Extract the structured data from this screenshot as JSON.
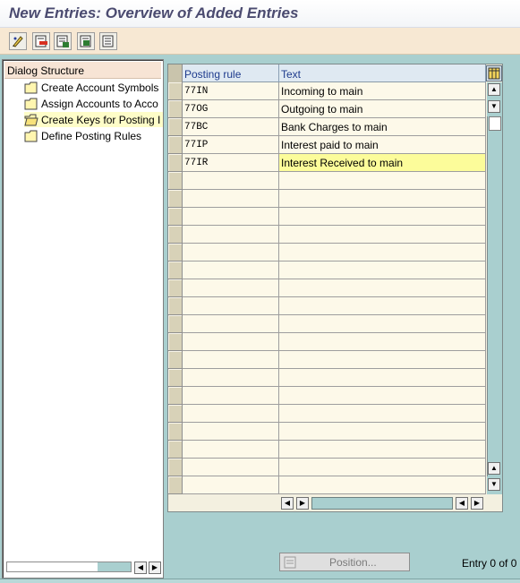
{
  "window": {
    "title": "New Entries: Overview of Added Entries"
  },
  "toolbar": {
    "buttons": [
      {
        "icon": "edit-pencil-icon"
      },
      {
        "icon": "delete-row-icon"
      },
      {
        "icon": "select-all-icon"
      },
      {
        "icon": "select-block-icon"
      },
      {
        "icon": "deselect-all-icon"
      }
    ]
  },
  "dialog_structure": {
    "header": "Dialog Structure",
    "items": [
      {
        "label": "Create Account Symbols",
        "icon": "folder-icon",
        "selected": false
      },
      {
        "label": "Assign Accounts to Acco",
        "icon": "folder-icon",
        "selected": false
      },
      {
        "label": "Create Keys for Posting I",
        "icon": "folder-open-icon",
        "selected": true
      },
      {
        "label": "Define Posting Rules",
        "icon": "folder-icon",
        "selected": false
      }
    ]
  },
  "table": {
    "columns": [
      "Posting rule",
      "Text"
    ],
    "rows": [
      {
        "code": "77IN",
        "text": "Incoming to main",
        "selected": false
      },
      {
        "code": "77OG",
        "text": "Outgoing to main",
        "selected": false
      },
      {
        "code": "77BC",
        "text": "Bank Charges to main",
        "selected": false
      },
      {
        "code": "77IP",
        "text": "Interest paid to main",
        "selected": false
      },
      {
        "code": "77IR",
        "text": "Interest Received to main",
        "selected": true
      }
    ],
    "empty_row_count": 18
  },
  "footer": {
    "position_button": "Position...",
    "entry_info": "Entry 0 of 0"
  },
  "colors": {
    "background": "#a9cfcf",
    "title_text": "#4b4b70",
    "toolbar_bg": "#f7e8d3",
    "selection_highlight": "#fcfc9a",
    "header_text": "#1e3b8d"
  }
}
